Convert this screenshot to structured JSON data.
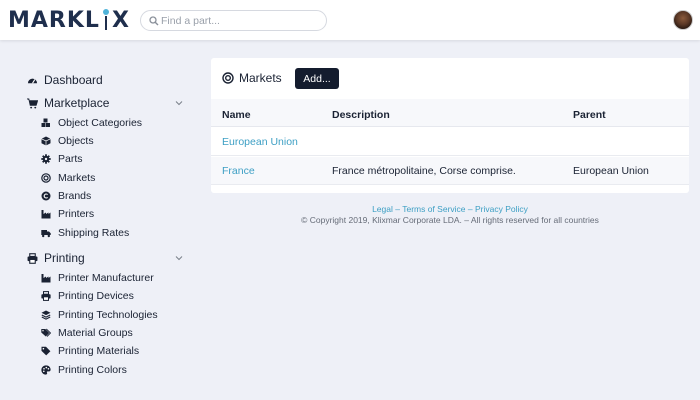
{
  "header": {
    "logo_left": "MARKL",
    "logo_right": "X",
    "logo_mid": "I",
    "search_placeholder": "Find a part..."
  },
  "sidebar": {
    "dashboard": "Dashboard",
    "marketplace": {
      "label": "Marketplace",
      "items": [
        "Object Categories",
        "Objects",
        "Parts",
        "Markets",
        "Brands",
        "Printers",
        "Shipping Rates"
      ]
    },
    "printing": {
      "label": "Printing",
      "items": [
        "Printer Manufacturer",
        "Printing Devices",
        "Printing Technologies",
        "Material Groups",
        "Printing Materials",
        "Printing Colors"
      ]
    }
  },
  "main": {
    "title": "Markets",
    "add_label": "Add...",
    "columns": [
      "Name",
      "Description",
      "Parent"
    ],
    "rows": [
      {
        "name": "European Union",
        "description": "",
        "parent": ""
      },
      {
        "name": "France",
        "description": "France métropolitaine, Corse comprise.",
        "parent": "European Union"
      }
    ]
  },
  "footer": {
    "legal": "Legal",
    "sep": "–",
    "terms": "Terms of Service",
    "privacy": "Privacy Policy",
    "copyright": "© Copyright 2019, Klixmar Corporate LDA. – All rights reserved for all countries"
  },
  "colors": {
    "brand_dark": "#1f2f4d",
    "accent": "#4fb3d9",
    "link": "#3d9fc4",
    "button": "#141c2e"
  }
}
